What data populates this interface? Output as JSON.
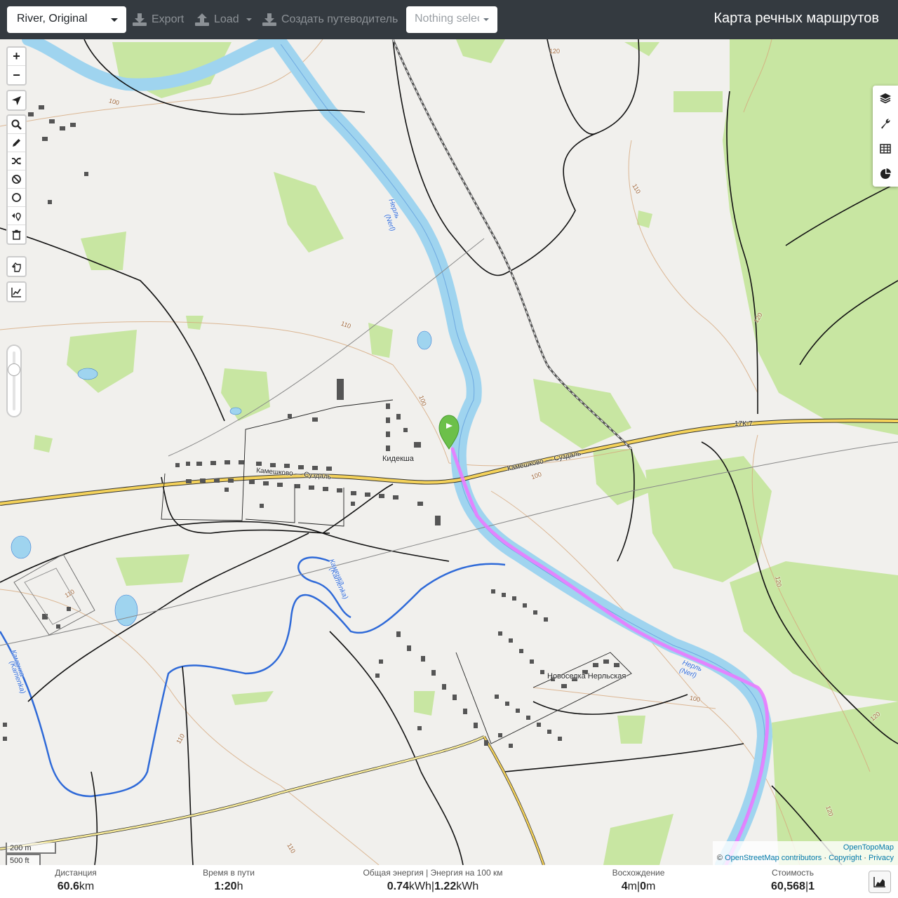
{
  "header": {
    "profile_select": "River, Original",
    "export_label": "Export",
    "load_label": "Load",
    "guide_label": "Создать путеводитель",
    "nothing_selected": "Nothing selected",
    "app_title": "Карта речных маршрутов"
  },
  "map": {
    "labels": {
      "village_kideksha": "Кидекша",
      "village_novoselka": "Новоселка Нерльская",
      "road_kameshkovo": "Камешково — Суздаль",
      "road_kameshkovo2": "Камешково — Суздаль",
      "road_17k7": "17К-7",
      "river_nerl_1": "Нерль",
      "river_nerl_1b": "(Nerl)",
      "river_nerl_2": "Нерль",
      "river_nerl_2b": "(Nerl)",
      "river_kamenka_1": "Каменка",
      "river_kamenka_1b": "(Kamenka)",
      "river_kamenka_2": "Каменка",
      "river_kamenka_2b": "(Kamenka)",
      "contour_100a": "100",
      "contour_100b": "100",
      "contour_100c": "100",
      "contour_100d": "100",
      "contour_110a": "110",
      "contour_110b": "110",
      "contour_110c": "110",
      "contour_110d": "110",
      "contour_110e": "110",
      "contour_120a": "120",
      "contour_120b": "120",
      "contour_120c": "120",
      "contour_120d": "120",
      "contour_120e": "120"
    },
    "scale": {
      "metric": "200 m",
      "imperial": "500 ft"
    },
    "attribution": {
      "opentopomap": "OpenTopoMap",
      "copyright_symbol": "©",
      "osm": "OpenStreetMap contributors",
      "sep1": "·",
      "copyright": "Copyright",
      "sep2": "·",
      "privacy": "Privacy"
    },
    "route_color": "#e97bff",
    "river_color": "#9fd4ef",
    "forest_color": "#c5e59f",
    "marker_color": "#6cc04a"
  },
  "controls": {
    "zoom_in": "+",
    "zoom_out": "−"
  },
  "stats": {
    "distance_label": "Дистанция",
    "distance_value": "60.6",
    "distance_unit": "km",
    "time_label": "Время в пути",
    "time_value": "1:20",
    "time_unit": "h",
    "energy_label": "Общая энергия | Энергия на 100 км",
    "energy_value1": "0.74",
    "energy_unit1": "kWh",
    "energy_sep": "|",
    "energy_value2": "1.22",
    "energy_unit2": "kWh",
    "ascent_label": "Восхождение",
    "ascent_value1": "4",
    "ascent_unit1": "m",
    "ascent_sep": "|",
    "ascent_value2": "0",
    "ascent_unit2": "m",
    "cost_label": "Стоимость",
    "cost_value1": "60,568",
    "cost_sep": "|",
    "cost_value2": "1"
  }
}
